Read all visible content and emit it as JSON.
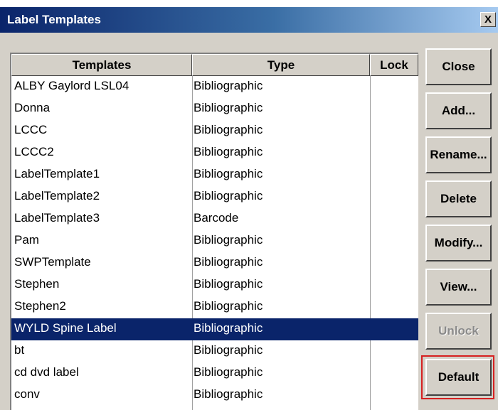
{
  "window": {
    "title": "Label Templates",
    "close_glyph": "X"
  },
  "table": {
    "columns": [
      "Templates",
      "Type",
      "Lock"
    ],
    "rows": [
      {
        "template": "ALBY Gaylord LSL04",
        "type": "Bibliographic"
      },
      {
        "template": "Donna",
        "type": "Bibliographic"
      },
      {
        "template": "LCCC",
        "type": "Bibliographic"
      },
      {
        "template": "LCCC2",
        "type": "Bibliographic"
      },
      {
        "template": "LabelTemplate1",
        "type": "Bibliographic"
      },
      {
        "template": "LabelTemplate2",
        "type": "Bibliographic"
      },
      {
        "template": "LabelTemplate3",
        "type": "Barcode"
      },
      {
        "template": "Pam",
        "type": "Bibliographic"
      },
      {
        "template": "SWPTemplate",
        "type": "Bibliographic"
      },
      {
        "template": "Stephen",
        "type": "Bibliographic"
      },
      {
        "template": "Stephen2",
        "type": "Bibliographic"
      },
      {
        "template": "WYLD Spine Label",
        "type": "Bibliographic"
      },
      {
        "template": "bt",
        "type": "Bibliographic"
      },
      {
        "template": "cd dvd label",
        "type": "Bibliographic"
      },
      {
        "template": "conv",
        "type": "Bibliographic"
      }
    ],
    "selected_index": 11
  },
  "buttons": {
    "close": "Close",
    "add": "Add...",
    "rename": "Rename...",
    "delete": "Delete",
    "modify": "Modify...",
    "view": "View...",
    "unlock": "Unlock",
    "default": "Default"
  },
  "colors": {
    "selection": "#0a246a",
    "highlight_frame": "#d62020"
  }
}
